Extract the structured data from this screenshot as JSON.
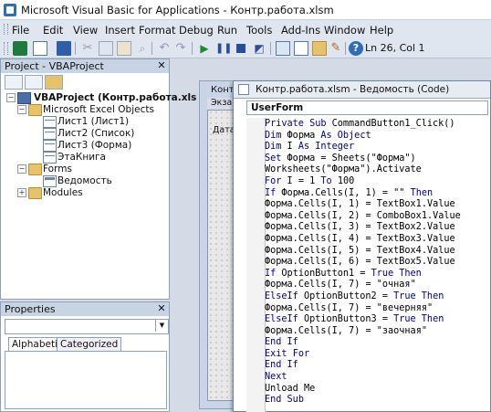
{
  "window": {
    "title": "Microsoft Visual Basic for Applications - Контр.работа.xlsm"
  },
  "menu": [
    "File",
    "Edit",
    "View",
    "Insert",
    "Format",
    "Debug",
    "Run",
    "Tools",
    "Add-Ins",
    "Window",
    "Help"
  ],
  "toolbar": {
    "position": "Ln 26, Col 1",
    "icons": [
      "excel-icon",
      "insert-userform-icon",
      "save-icon",
      "cut-icon",
      "copy-icon",
      "paste-icon",
      "find-icon",
      "undo-icon",
      "redo-icon",
      "run-icon",
      "break-icon",
      "reset-icon",
      "design-mode-icon",
      "project-explorer-icon",
      "properties-icon",
      "object-browser-icon",
      "toolbox-icon",
      "help-icon"
    ]
  },
  "project_panel": {
    "title": "Project - VBAProject",
    "tree": [
      {
        "label": "VBAProject (Контр.работа.xls",
        "bold": true
      },
      {
        "label": "Microsoft Excel Objects"
      },
      {
        "label": "Лист1 (Лист1)"
      },
      {
        "label": "Лист2 (Список)"
      },
      {
        "label": "Лист3 (Форма)"
      },
      {
        "label": "ЭтаКнига"
      },
      {
        "label": "Forms"
      },
      {
        "label": "Ведомость"
      },
      {
        "label": "Modules"
      }
    ]
  },
  "properties_panel": {
    "title": "Properties",
    "tabs": [
      "Alphabetic",
      "Categorized"
    ]
  },
  "designer_window": {
    "title": "Конт",
    "form_title": "Экза",
    "label": "Дата"
  },
  "code_window": {
    "title": "Контр.работа.xlsm - Ведомость (Code)",
    "object_combo": "UserForm",
    "lines": [
      "Private Sub CommandButton1_Click()",
      "Dim Форма As Object",
      "Dim I As Integer",
      "Set Форма = Sheets(\"Форма\")",
      "Worksheets(\"Форма\").Activate",
      "For I = 1 To 100",
      "If Форма.Cells(I, 1) = \"\" Then",
      "Форма.Cells(I, 1) = TextBox1.Value",
      "Форма.Cells(I, 2) = ComboBox1.Value",
      "Форма.Cells(I, 3) = TextBox2.Value",
      "Форма.Cells(I, 4) = TextBox3.Value",
      "Форма.Cells(I, 5) = TextBox4.Value",
      "Форма.Cells(I, 6) = TextBox5.Value",
      "If OptionButton1 = True Then",
      "Форма.Cells(I, 7) = \"очная\"",
      "ElseIf OptionButton2 = True Then",
      "Форма.Cells(I, 7) = \"вечерняя\"",
      "ElseIf OptionButton3 = True Then",
      "Форма.Cells(I, 7) = \"заочная\"",
      "End If",
      "Exit For",
      "End If",
      "Next",
      "Unload Me",
      "End Sub"
    ]
  }
}
